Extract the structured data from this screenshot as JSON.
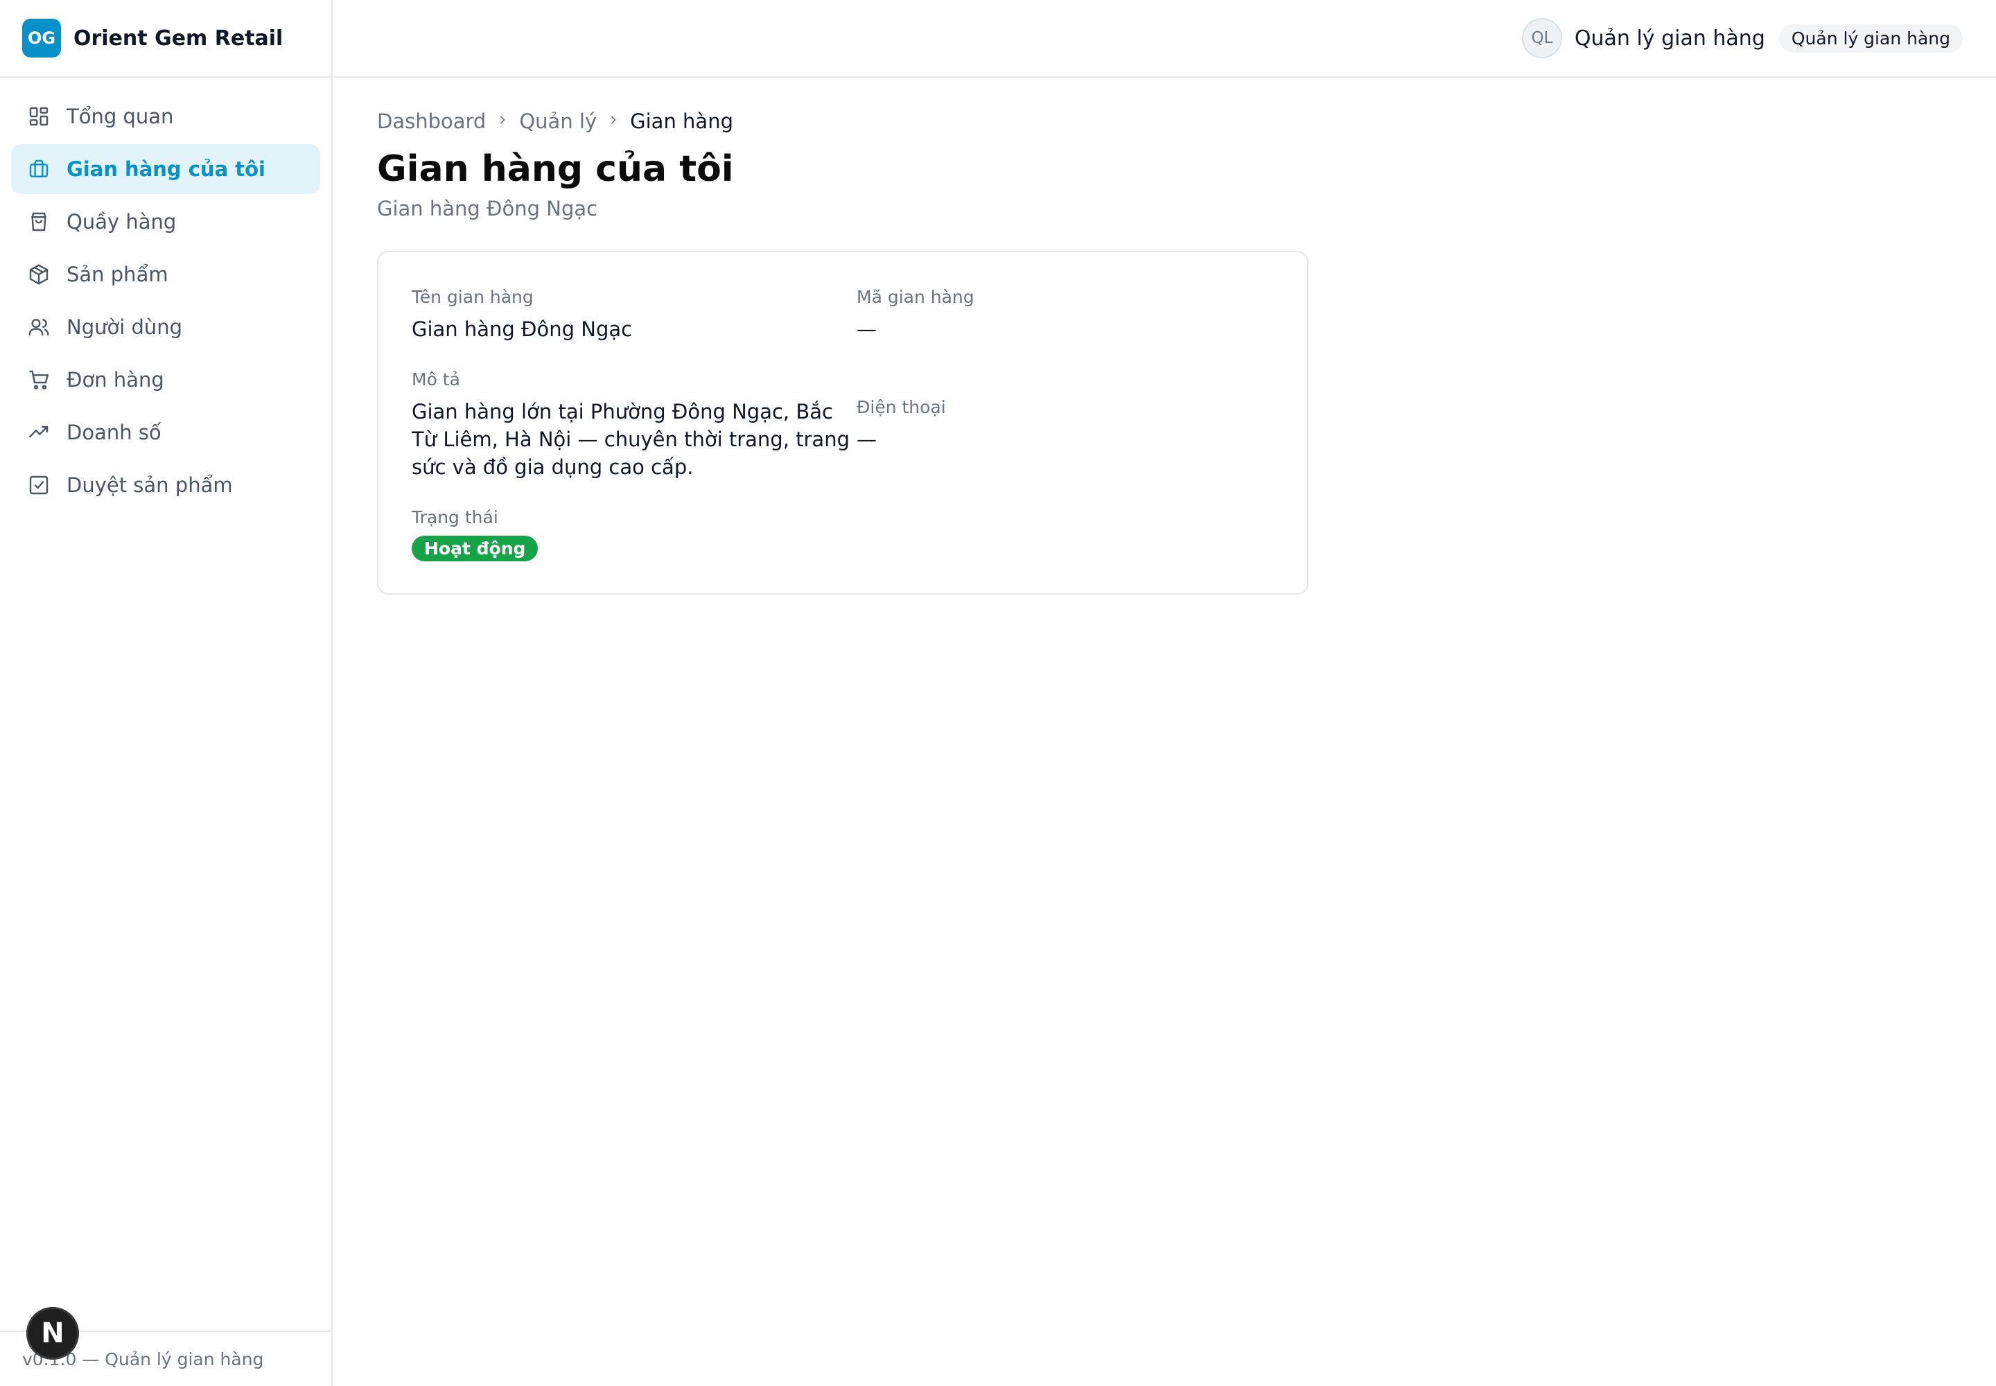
{
  "brand": {
    "logo_text": "OG",
    "name": "Orient Gem Retail",
    "logo_color": "#0891c9"
  },
  "sidebar": {
    "items": [
      {
        "label": "Tổng quan",
        "icon": "dashboard-icon",
        "active": false
      },
      {
        "label": "Gian hàng của tôi",
        "icon": "store-icon",
        "active": true
      },
      {
        "label": "Quầy hàng",
        "icon": "shopping-bag-icon",
        "active": false
      },
      {
        "label": "Sản phẩm",
        "icon": "package-icon",
        "active": false
      },
      {
        "label": "Người dùng",
        "icon": "users-icon",
        "active": false
      },
      {
        "label": "Đơn hàng",
        "icon": "cart-icon",
        "active": false
      },
      {
        "label": "Doanh số",
        "icon": "trending-up-icon",
        "active": false
      },
      {
        "label": "Duyệt sản phẩm",
        "icon": "check-square-icon",
        "active": false
      }
    ],
    "footer": "v0.1.0 — Quản lý gian hàng",
    "next_badge": "N"
  },
  "topbar": {
    "avatar": "QL",
    "user_name": "Quản lý gian hàng",
    "role": "Quản lý gian hàng"
  },
  "breadcrumb": [
    "Dashboard",
    "Quản lý",
    "Gian hàng"
  ],
  "page": {
    "title": "Gian hàng của tôi",
    "subtitle": "Gian hàng Đông Ngạc"
  },
  "details": {
    "name_label": "Tên gian hàng",
    "name_value": "Gian hàng Đông Ngạc",
    "code_label": "Mã gian hàng",
    "code_value": "—",
    "desc_label": "Mô tả",
    "desc_value": "Gian hàng lớn tại Phường Đông Ngạc, Bắc Từ Liêm, Hà Nội — chuyên thời trang, trang sức và đồ gia dụng cao cấp.",
    "phone_label": "Điện thoại",
    "phone_value": "—",
    "status_label": "Trạng thái",
    "status_value": "Hoạt động",
    "status_color": "#16a34a"
  }
}
